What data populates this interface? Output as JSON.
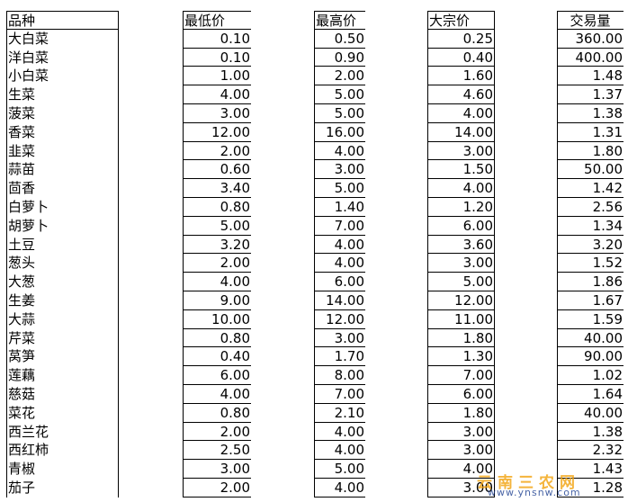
{
  "header": {
    "name": "品种",
    "low": "最低价",
    "high": "最高价",
    "bulk": "大宗价",
    "volume": "交易量"
  },
  "rows": [
    {
      "name": "大白菜",
      "low": "0.10",
      "high": "0.50",
      "bulk": "0.25",
      "volume": "360.00"
    },
    {
      "name": "洋白菜",
      "low": "0.10",
      "high": "0.90",
      "bulk": "0.40",
      "volume": "400.00"
    },
    {
      "name": "小白菜",
      "low": "1.00",
      "high": "2.00",
      "bulk": "1.60",
      "volume": "1.48"
    },
    {
      "name": "生菜",
      "low": "4.00",
      "high": "5.00",
      "bulk": "4.60",
      "volume": "1.37"
    },
    {
      "name": "菠菜",
      "low": "3.00",
      "high": "5.00",
      "bulk": "4.00",
      "volume": "1.38"
    },
    {
      "name": "香菜",
      "low": "12.00",
      "high": "16.00",
      "bulk": "14.00",
      "volume": "1.31"
    },
    {
      "name": "韭菜",
      "low": "2.00",
      "high": "4.00",
      "bulk": "3.00",
      "volume": "1.80"
    },
    {
      "name": "蒜苗",
      "low": "0.60",
      "high": "3.00",
      "bulk": "1.50",
      "volume": "50.00"
    },
    {
      "name": "茴香",
      "low": "3.40",
      "high": "5.00",
      "bulk": "4.00",
      "volume": "1.42"
    },
    {
      "name": "白萝卜",
      "low": "0.80",
      "high": "1.40",
      "bulk": "1.20",
      "volume": "2.56"
    },
    {
      "name": "胡萝卜",
      "low": "5.00",
      "high": "7.00",
      "bulk": "6.00",
      "volume": "1.34"
    },
    {
      "name": "土豆",
      "low": "3.20",
      "high": "4.00",
      "bulk": "3.60",
      "volume": "3.20"
    },
    {
      "name": "葱头",
      "low": "2.00",
      "high": "4.00",
      "bulk": "3.00",
      "volume": "1.52"
    },
    {
      "name": "大葱",
      "low": "4.00",
      "high": "6.00",
      "bulk": "5.00",
      "volume": "1.86"
    },
    {
      "name": "生姜",
      "low": "9.00",
      "high": "14.00",
      "bulk": "12.00",
      "volume": "1.67"
    },
    {
      "name": "大蒜",
      "low": "10.00",
      "high": "12.00",
      "bulk": "11.00",
      "volume": "1.59"
    },
    {
      "name": "芹菜",
      "low": "0.80",
      "high": "3.00",
      "bulk": "1.80",
      "volume": "40.00"
    },
    {
      "name": "莴笋",
      "low": "0.40",
      "high": "1.70",
      "bulk": "1.30",
      "volume": "90.00"
    },
    {
      "name": "莲藕",
      "low": "6.00",
      "high": "8.00",
      "bulk": "7.00",
      "volume": "1.02"
    },
    {
      "name": "慈菇",
      "low": "4.00",
      "high": "7.00",
      "bulk": "6.00",
      "volume": "1.64"
    },
    {
      "name": "菜花",
      "low": "0.80",
      "high": "2.10",
      "bulk": "1.80",
      "volume": "40.00"
    },
    {
      "name": "西兰花",
      "low": "2.00",
      "high": "4.00",
      "bulk": "3.00",
      "volume": "1.38"
    },
    {
      "name": "西红柿",
      "low": "2.50",
      "high": "4.00",
      "bulk": "3.00",
      "volume": "2.32"
    },
    {
      "name": "青椒",
      "low": "3.00",
      "high": "5.00",
      "bulk": "4.00",
      "volume": "1.43"
    },
    {
      "name": "茄子",
      "low": "2.00",
      "high": "4.00",
      "bulk": "3.00",
      "volume": "1.28"
    }
  ],
  "watermark": {
    "main": "云南三农网",
    "sub": "www.ynsnw.com"
  }
}
